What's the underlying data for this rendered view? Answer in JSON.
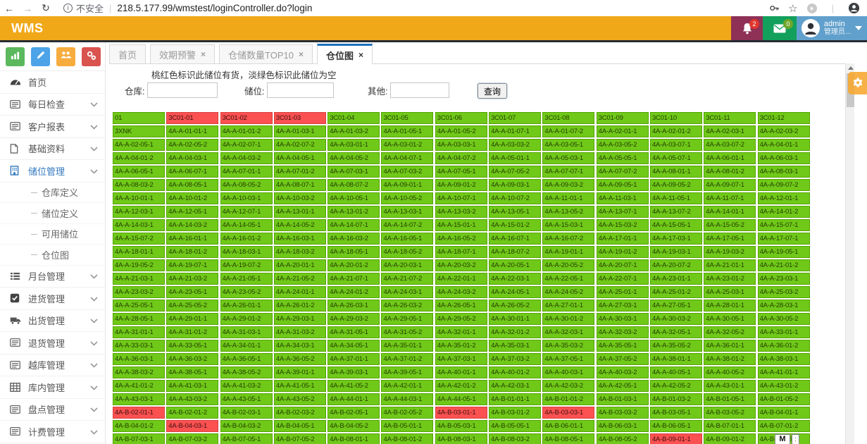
{
  "browser": {
    "security_label": "不安全",
    "url": "218.5.177.99/wmstest/loginController.do?login"
  },
  "header": {
    "app_title": "WMS",
    "notifications_count": "2",
    "messages_count": "0",
    "user_name": "admin",
    "user_role": "管理员...",
    "colors": {
      "bar": "#F0A818",
      "bell_block": "#8F3156",
      "mail_block": "#12A05C",
      "user_block": "#61A0CC"
    }
  },
  "sidebar": {
    "quick_buttons": [
      {
        "name": "chart-button",
        "icon": "chart-bars-icon",
        "color": "#5CB85C"
      },
      {
        "name": "edit-button",
        "icon": "pencil-icon",
        "color": "#4DA3E8"
      },
      {
        "name": "users-button",
        "icon": "users-icon",
        "color": "#F7AC3E"
      },
      {
        "name": "settings-button",
        "icon": "gears-icon",
        "color": "#D9534F"
      }
    ],
    "items": [
      {
        "label": "首页",
        "icon": "gauge-icon",
        "expandable": false,
        "active": false
      },
      {
        "label": "每日检查",
        "icon": "list-icon",
        "expandable": true,
        "active": false
      },
      {
        "label": "客户报表",
        "icon": "list-icon",
        "expandable": true,
        "active": false
      },
      {
        "label": "基础资料",
        "icon": "file-icon",
        "expandable": true,
        "active": false
      },
      {
        "label": "储位管理",
        "icon": "building-icon",
        "expandable": true,
        "active": true,
        "submenu": [
          "仓库定义",
          "储位定义",
          "可用储位",
          "仓位图"
        ]
      },
      {
        "label": "月台管理",
        "icon": "menu-icon",
        "expandable": true,
        "active": false
      },
      {
        "label": "进货管理",
        "icon": "check-icon",
        "expandable": true,
        "active": false
      },
      {
        "label": "出货管理",
        "icon": "truck-icon",
        "expandable": true,
        "active": false
      },
      {
        "label": "退货管理",
        "icon": "list-icon",
        "expandable": true,
        "active": false
      },
      {
        "label": "越库管理",
        "icon": "list-icon",
        "expandable": true,
        "active": false
      },
      {
        "label": "库内管理",
        "icon": "grid-icon",
        "expandable": true,
        "active": false
      },
      {
        "label": "盘点管理",
        "icon": "list-icon",
        "expandable": true,
        "active": false
      },
      {
        "label": "计费管理",
        "icon": "list-icon",
        "expandable": true,
        "active": false
      }
    ]
  },
  "tabs": [
    {
      "label": "首页",
      "closable": false,
      "active": false
    },
    {
      "label": "效期预警",
      "closable": true,
      "active": false
    },
    {
      "label": "仓储数量TOP10",
      "closable": true,
      "active": false
    },
    {
      "label": "仓位图",
      "closable": true,
      "active": true
    }
  ],
  "panel": {
    "legend": "桃红色标识此储位有货，淡绿色标识此储位为空",
    "filters": [
      {
        "id": "warehouse",
        "label": "仓库:",
        "value": "",
        "placeholder": ""
      },
      {
        "id": "location",
        "label": "储位:",
        "value": "",
        "placeholder": ""
      },
      {
        "id": "other",
        "label": "其他:",
        "value": "",
        "placeholder": ""
      }
    ],
    "search_button": "查询"
  },
  "grid": {
    "colors": {
      "empty": "#70C919",
      "occupied": "#FB5151"
    },
    "occupied_cells": [
      "3C01-01",
      "3C01-02",
      "3C01-03",
      "4A-B-02-01-1",
      "4A-B-03-01-1",
      "4A-B-03-03-1",
      "4A-B-04-03-1",
      "4A-B-09-01-1"
    ],
    "rows": [
      [
        "01",
        "3C01-01",
        "3C01-02",
        "3C01-03",
        "3C01-04",
        "3C01-05",
        "3C01-06",
        "3C01-07",
        "3C01-08",
        "3C01-09",
        "3C01-10",
        "3C01-11",
        "3C01-12"
      ],
      [
        "3XNK",
        "4A-A-01-01-1",
        "4A-A-01-01-2",
        "4A-A-01-03-1",
        "4A-A-01-03-2",
        "4A-A-01-05-1",
        "4A-A-01-05-2",
        "4A-A-01-07-1",
        "4A-A-01-07-2",
        "4A-A-02-01-1",
        "4A-A-02-01-2",
        "4A-A-02-03-1",
        "4A-A-02-03-2"
      ],
      [
        "4A-A-02-05-1",
        "4A-A-02-05-2",
        "4A-A-02-07-1",
        "4A-A-02-07-2",
        "4A-A-03-01-1",
        "4A-A-03-01-2",
        "4A-A-03-03-1",
        "4A-A-03-03-2",
        "4A-A-03-05-1",
        "4A-A-03-05-2",
        "4A-A-03-07-1",
        "4A-A-03-07-2",
        "4A-A-04-01-1"
      ],
      [
        "4A-A-04-01-2",
        "4A-A-04-03-1",
        "4A-A-04-03-2",
        "4A-A-04-05-1",
        "4A-A-04-05-2",
        "4A-A-04-07-1",
        "4A-A-04-07-2",
        "4A-A-05-01-1",
        "4A-A-05-03-1",
        "4A-A-05-05-1",
        "4A-A-05-07-1",
        "4A-A-06-01-1",
        "4A-A-06-03-1"
      ],
      [
        "4A-A-06-05-1",
        "4A-A-06-07-1",
        "4A-A-07-01-1",
        "4A-A-07-01-2",
        "4A-A-07-03-1",
        "4A-A-07-03-2",
        "4A-A-07-05-1",
        "4A-A-07-05-2",
        "4A-A-07-07-1",
        "4A-A-07-07-2",
        "4A-A-08-01-1",
        "4A-A-08-01-2",
        "4A-A-08-03-1"
      ],
      [
        "4A-A-08-03-2",
        "4A-A-08-05-1",
        "4A-A-08-05-2",
        "4A-A-08-07-1",
        "4A-A-08-07-2",
        "4A-A-09-01-1",
        "4A-A-09-01-2",
        "4A-A-09-03-1",
        "4A-A-09-03-2",
        "4A-A-09-05-1",
        "4A-A-09-05-2",
        "4A-A-09-07-1",
        "4A-A-09-07-2"
      ],
      [
        "4A-A-10-01-1",
        "4A-A-10-01-2",
        "4A-A-10-03-1",
        "4A-A-10-03-2",
        "4A-A-10-05-1",
        "4A-A-10-05-2",
        "4A-A-10-07-1",
        "4A-A-10-07-2",
        "4A-A-11-01-1",
        "4A-A-11-03-1",
        "4A-A-11-05-1",
        "4A-A-11-07-1",
        "4A-A-12-01-1"
      ],
      [
        "4A-A-12-03-1",
        "4A-A-12-05-1",
        "4A-A-12-07-1",
        "4A-A-13-01-1",
        "4A-A-13-01-2",
        "4A-A-13-03-1",
        "4A-A-13-03-2",
        "4A-A-13-05-1",
        "4A-A-13-05-2",
        "4A-A-13-07-1",
        "4A-A-13-07-2",
        "4A-A-14-01-1",
        "4A-A-14-01-2"
      ],
      [
        "4A-A-14-03-1",
        "4A-A-14-03-2",
        "4A-A-14-05-1",
        "4A-A-14-05-2",
        "4A-A-14-07-1",
        "4A-A-14-07-2",
        "4A-A-15-01-1",
        "4A-A-15-01-2",
        "4A-A-15-03-1",
        "4A-A-15-03-2",
        "4A-A-15-05-1",
        "4A-A-15-05-2",
        "4A-A-15-07-1"
      ],
      [
        "4A-A-15-07-2",
        "4A-A-16-01-1",
        "4A-A-16-01-2",
        "4A-A-16-03-1",
        "4A-A-16-03-2",
        "4A-A-16-05-1",
        "4A-A-16-05-2",
        "4A-A-16-07-1",
        "4A-A-16-07-2",
        "4A-A-17-01-1",
        "4A-A-17-03-1",
        "4A-A-17-05-1",
        "4A-A-17-07-1"
      ],
      [
        "4A-A-18-01-1",
        "4A-A-18-01-2",
        "4A-A-18-03-1",
        "4A-A-18-03-2",
        "4A-A-18-05-1",
        "4A-A-18-05-2",
        "4A-A-18-07-1",
        "4A-A-18-07-2",
        "4A-A-19-01-1",
        "4A-A-19-01-2",
        "4A-A-19-03-1",
        "4A-A-19-03-2",
        "4A-A-19-05-1"
      ],
      [
        "4A-A-19-05-2",
        "4A-A-19-07-1",
        "4A-A-19-07-2",
        "4A-A-20-01-1",
        "4A-A-20-01-2",
        "4A-A-20-03-1",
        "4A-A-20-03-2",
        "4A-A-20-05-1",
        "4A-A-20-05-2",
        "4A-A-20-07-1",
        "4A-A-20-07-2",
        "4A-A-21-01-1",
        "4A-A-21-01-2"
      ],
      [
        "4A-A-21-03-1",
        "4A-A-21-03-2",
        "4A-A-21-05-1",
        "4A-A-21-05-2",
        "4A-A-21-07-1",
        "4A-A-21-07-2",
        "4A-A-22-01-1",
        "4A-A-22-03-1",
        "4A-A-22-05-1",
        "4A-A-22-07-1",
        "4A-A-23-01-1",
        "4A-A-23-01-2",
        "4A-A-23-03-1"
      ],
      [
        "4A-A-23-03-2",
        "4A-A-23-05-1",
        "4A-A-23-05-2",
        "4A-A-24-01-1",
        "4A-A-24-01-2",
        "4A-A-24-03-1",
        "4A-A-24-03-2",
        "4A-A-24-05-1",
        "4A-A-24-05-2",
        "4A-A-25-01-1",
        "4A-A-25-01-2",
        "4A-A-25-03-1",
        "4A-A-25-03-2"
      ],
      [
        "4A-A-25-05-1",
        "4A-A-25-05-2",
        "4A-A-26-01-1",
        "4A-A-26-01-2",
        "4A-A-26-03-1",
        "4A-A-26-03-2",
        "4A-A-26-05-1",
        "4A-A-26-05-2",
        "4A-A-27-01-1",
        "4A-A-27-03-1",
        "4A-A-27-05-1",
        "4A-A-28-01-1",
        "4A-A-28-03-1"
      ],
      [
        "4A-A-28-05-1",
        "4A-A-29-01-1",
        "4A-A-29-01-2",
        "4A-A-29-03-1",
        "4A-A-29-03-2",
        "4A-A-29-05-1",
        "4A-A-29-05-2",
        "4A-A-30-01-1",
        "4A-A-30-01-2",
        "4A-A-30-03-1",
        "4A-A-30-03-2",
        "4A-A-30-05-1",
        "4A-A-30-05-2"
      ],
      [
        "4A-A-31-01-1",
        "4A-A-31-01-2",
        "4A-A-31-03-1",
        "4A-A-31-03-2",
        "4A-A-31-05-1",
        "4A-A-31-05-2",
        "4A-A-32-01-1",
        "4A-A-32-01-2",
        "4A-A-32-03-1",
        "4A-A-32-03-2",
        "4A-A-32-05-1",
        "4A-A-32-05-2",
        "4A-A-33-01-1"
      ],
      [
        "4A-A-33-03-1",
        "4A-A-33-05-1",
        "4A-A-34-01-1",
        "4A-A-34-03-1",
        "4A-A-34-05-1",
        "4A-A-35-01-1",
        "4A-A-35-01-2",
        "4A-A-35-03-1",
        "4A-A-35-03-2",
        "4A-A-35-05-1",
        "4A-A-35-05-2",
        "4A-A-36-01-1",
        "4A-A-36-01-2"
      ],
      [
        "4A-A-36-03-1",
        "4A-A-36-03-2",
        "4A-A-36-05-1",
        "4A-A-36-05-2",
        "4A-A-37-01-1",
        "4A-A-37-01-2",
        "4A-A-37-03-1",
        "4A-A-37-03-2",
        "4A-A-37-05-1",
        "4A-A-37-05-2",
        "4A-A-38-01-1",
        "4A-A-38-01-2",
        "4A-A-38-03-1"
      ],
      [
        "4A-A-38-03-2",
        "4A-A-38-05-1",
        "4A-A-38-05-2",
        "4A-A-39-01-1",
        "4A-A-39-03-1",
        "4A-A-39-05-1",
        "4A-A-40-01-1",
        "4A-A-40-01-2",
        "4A-A-40-03-1",
        "4A-A-40-03-2",
        "4A-A-40-05-1",
        "4A-A-40-05-2",
        "4A-A-41-01-1"
      ],
      [
        "4A-A-41-01-2",
        "4A-A-41-03-1",
        "4A-A-41-03-2",
        "4A-A-41-05-1",
        "4A-A-41-05-2",
        "4A-A-42-01-1",
        "4A-A-42-01-2",
        "4A-A-42-03-1",
        "4A-A-42-03-2",
        "4A-A-42-05-1",
        "4A-A-42-05-2",
        "4A-A-43-01-1",
        "4A-A-43-01-2"
      ],
      [
        "4A-A-43-03-1",
        "4A-A-43-03-2",
        "4A-A-43-05-1",
        "4A-A-43-05-2",
        "4A-A-44-01-1",
        "4A-A-44-03-1",
        "4A-A-44-05-1",
        "4A-B-01-01-1",
        "4A-B-01-01-2",
        "4A-B-01-03-1",
        "4A-B-01-03-2",
        "4A-B-01-05-1",
        "4A-B-01-05-2"
      ],
      [
        "4A-B-02-01-1",
        "4A-B-02-01-2",
        "4A-B-02-03-1",
        "4A-B-02-03-2",
        "4A-B-02-05-1",
        "4A-B-02-05-2",
        "4A-B-03-01-1",
        "4A-B-03-01-2",
        "4A-B-03-03-1",
        "4A-B-03-03-2",
        "4A-B-03-05-1",
        "4A-B-03-05-2",
        "4A-B-04-01-1"
      ],
      [
        "4A-B-04-01-2",
        "4A-B-04-03-1",
        "4A-B-04-03-2",
        "4A-B-04-05-1",
        "4A-B-04-05-2",
        "4A-B-05-01-1",
        "4A-B-05-03-1",
        "4A-B-05-05-1",
        "4A-B-06-01-1",
        "4A-B-06-03-1",
        "4A-B-06-05-1",
        "4A-B-07-01-1",
        "4A-B-07-01-2"
      ],
      [
        "4A-B-07-03-1",
        "4A-B-07-03-2",
        "4A-B-07-05-1",
        "4A-B-07-05-2",
        "4A-B-08-01-1",
        "4A-B-08-01-2",
        "4A-B-08-03-1",
        "4A-B-08-03-2",
        "4A-B-08-05-1",
        "4A-B-08-05-2",
        "4A-B-09-01-1",
        "4A-B-09-01-2",
        "4A-B-09-03-1"
      ]
    ]
  },
  "ime": {
    "label": "M",
    "dots": ":"
  }
}
